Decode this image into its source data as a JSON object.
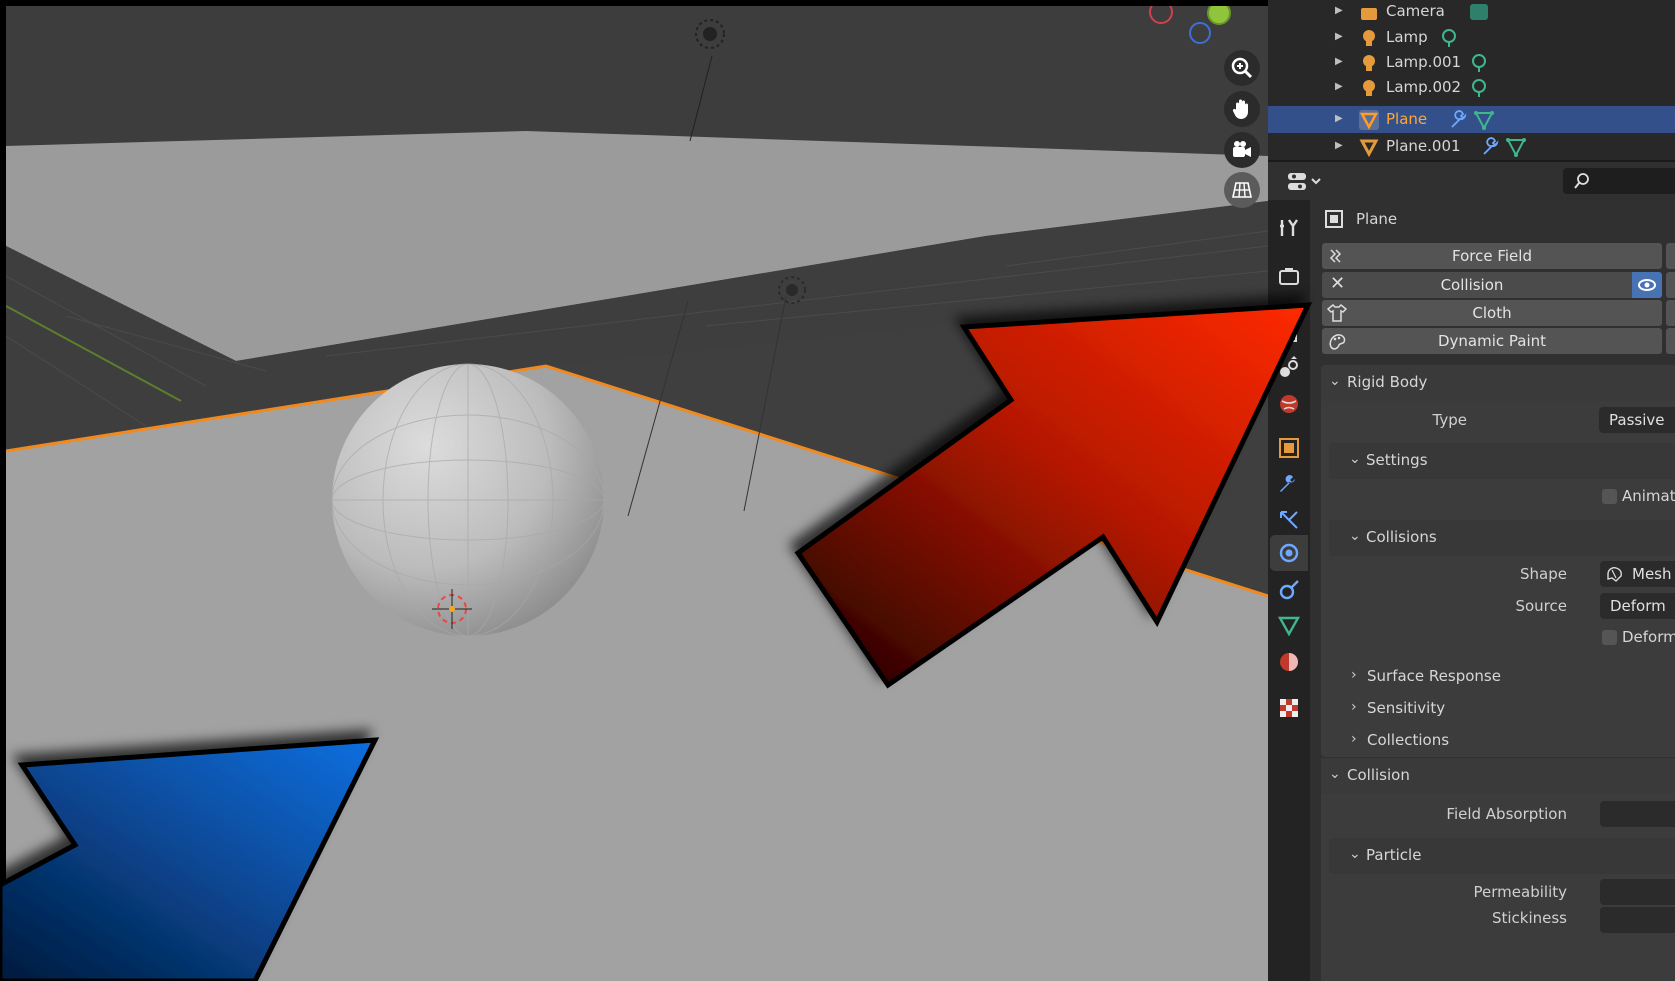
{
  "outliner": {
    "items": [
      {
        "name": "Camera",
        "selected": false
      },
      {
        "name": "Lamp",
        "selected": false
      },
      {
        "name": "Lamp.001",
        "selected": false
      },
      {
        "name": "Lamp.002",
        "selected": false
      },
      {
        "name": "Plane",
        "selected": true
      },
      {
        "name": "Plane.001",
        "selected": false
      }
    ]
  },
  "properties": {
    "object_name": "Plane",
    "physics_buttons": {
      "force_field": "Force Field",
      "collision": "Collision",
      "cloth": "Cloth",
      "dynamic_paint": "Dynamic Paint"
    },
    "rigid_body": {
      "title": "Rigid Body",
      "type_label": "Type",
      "type_value": "Passive",
      "settings_title": "Settings",
      "animated_label": "Animated",
      "collisions_title": "Collisions",
      "shape_label": "Shape",
      "shape_value": "Mesh",
      "source_label": "Source",
      "source_value": "Deform",
      "deforming_label": "Deforming",
      "surface_response": "Surface Response",
      "sensitivity": "Sensitivity",
      "collections": "Collections"
    },
    "collision": {
      "title": "Collision",
      "field_absorption_label": "Field Absorption",
      "particle_title": "Particle",
      "permeability_label": "Permeability",
      "stickiness_label": "Stickiness"
    }
  },
  "colors": {
    "selection_outline": "#f08a1e",
    "outliner_selected_bg": "#33508a",
    "red_arrow": "#ff2a00",
    "blue_arrow": "#0a5fc2"
  },
  "icons": {
    "viewport_nav": [
      "zoom-icon",
      "hand-pan-icon",
      "camera-view-icon",
      "grid-ortho-icon"
    ]
  }
}
